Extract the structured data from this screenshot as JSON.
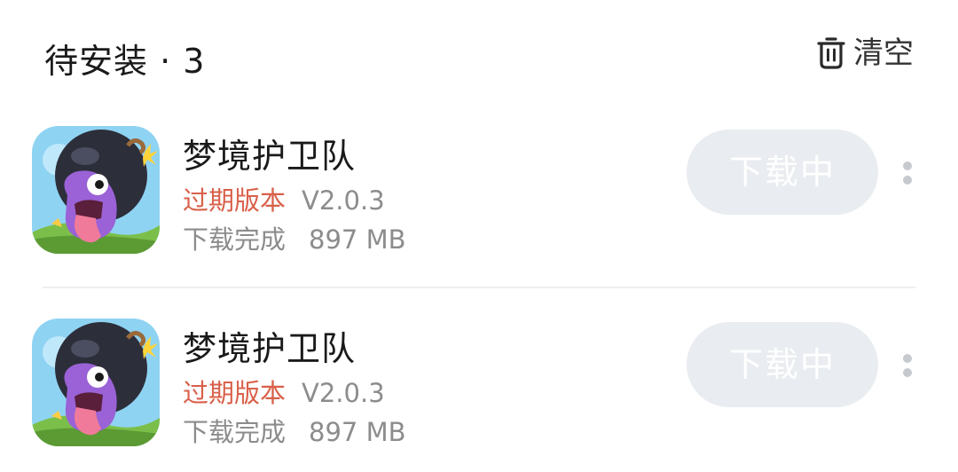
{
  "section": {
    "title": "待安装 · 3",
    "clear_label": "清空",
    "clear_icon": "trash-icon"
  },
  "items": [
    {
      "name": "梦境护卫队",
      "status_tag": "过期版本",
      "version": "V2.0.3",
      "download_status": "下载完成",
      "size": "897 MB",
      "button_label": "下载中",
      "icon": "app-icon-bomb-monster"
    },
    {
      "name": "梦境护卫队",
      "status_tag": "过期版本",
      "version": "V2.0.3",
      "download_status": "下载完成",
      "size": "897 MB",
      "button_label": "下载中",
      "icon": "app-icon-bomb-monster"
    }
  ],
  "colors": {
    "expired_tag": "#d9604a",
    "secondary_text": "#8c8c8c",
    "button_bg": "#e9ecf0",
    "button_text": "#ffffff"
  }
}
